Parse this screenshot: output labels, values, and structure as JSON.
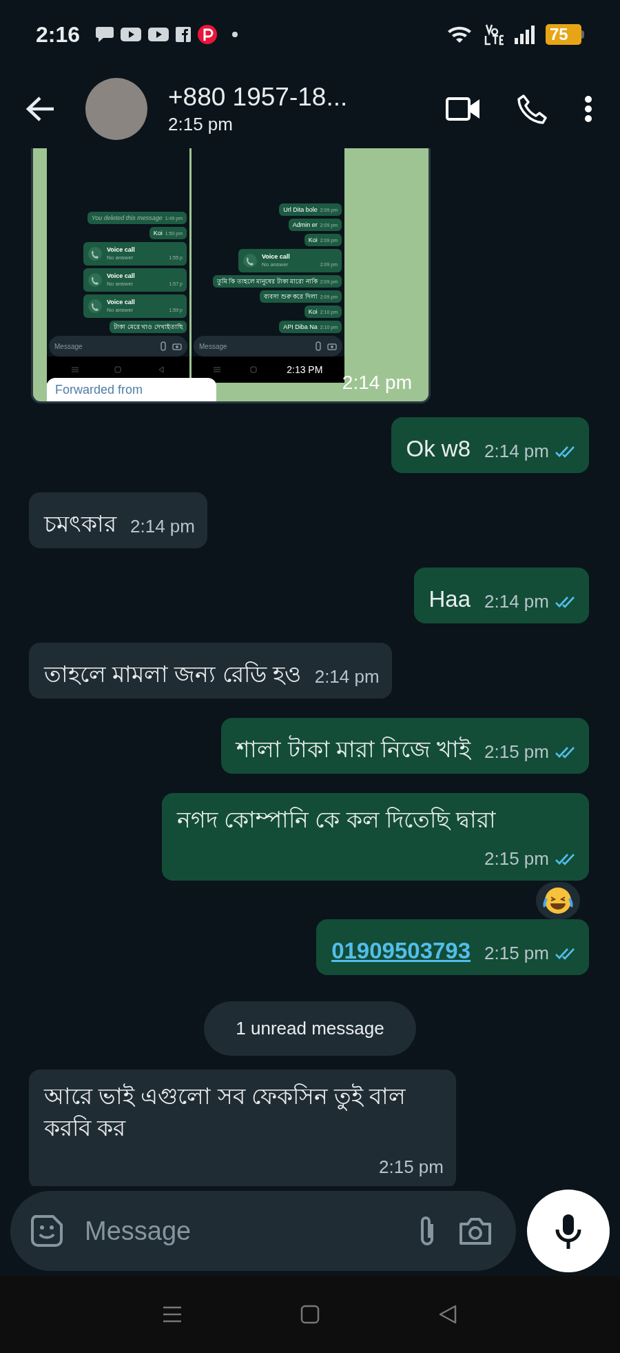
{
  "status_bar": {
    "time": "2:16",
    "battery": "75"
  },
  "header": {
    "contact": "+880 1957-18...",
    "subtitle": "2:15 pm"
  },
  "messages": [
    {
      "kind": "image",
      "outgoing": false,
      "time": "2:14 pm",
      "forwarded_label": "Forwarded from",
      "screens": [
        {
          "items": [
            {
              "kind": "deleted",
              "text": "You deleted this message",
              "time": "1:49 pm"
            },
            {
              "kind": "text",
              "text": "Koi",
              "time": "1:50 pm"
            },
            {
              "kind": "call",
              "title": "Voice call",
              "sub": "No answer",
              "time": "1:55 p"
            },
            {
              "kind": "call",
              "title": "Voice call",
              "sub": "No answer",
              "time": "1:57 p"
            },
            {
              "kind": "call",
              "title": "Voice call",
              "sub": "No answer",
              "time": "1:59 p"
            },
            {
              "kind": "text",
              "text": "টাকা মেরে খাও দেখাইতাছি"
            }
          ],
          "placeholder": "Message"
        },
        {
          "items": [
            {
              "kind": "text",
              "text": "Url Dita bole",
              "time": "2:09 pm"
            },
            {
              "kind": "text",
              "text": "Admin er",
              "time": "2:09 pm"
            },
            {
              "kind": "text",
              "text": "Koi",
              "time": "2:09 pm"
            },
            {
              "kind": "call",
              "title": "Voice call",
              "sub": "No answer",
              "time": "2:09 pm"
            },
            {
              "kind": "text",
              "text": "তুমি কি তাহলে মানুষের টাকা মারো নাকি",
              "time": "2:09 pm"
            },
            {
              "kind": "text",
              "text": "ব্যবসা শুরু করে দিলা",
              "time": "2:09 pm"
            },
            {
              "kind": "text",
              "text": "Koi",
              "time": "2:10 pm"
            },
            {
              "kind": "text",
              "text": "API Diba Na",
              "time": "2:10 pm"
            }
          ],
          "placeholder": "Message",
          "clock": "2:13 PM"
        }
      ]
    },
    {
      "kind": "text",
      "outgoing": true,
      "text": "Ok w8",
      "time": "2:14 pm",
      "read": true
    },
    {
      "kind": "text",
      "outgoing": false,
      "text": "চমৎকার",
      "time": "2:14 pm"
    },
    {
      "kind": "text",
      "outgoing": true,
      "text": "Haa",
      "time": "2:14 pm",
      "read": true
    },
    {
      "kind": "text",
      "outgoing": false,
      "text": "তাহলে মামলা জন্য রেডি হও",
      "time": "2:14 pm"
    },
    {
      "kind": "text",
      "outgoing": true,
      "text": "শালা টাকা মারা নিজে খাই",
      "time": "2:15 pm",
      "read": true
    },
    {
      "kind": "text",
      "outgoing": true,
      "text": "নগদ কোম্পানি কে কল দিতেছি দ্বারা",
      "time": "2:15 pm",
      "read": true,
      "reaction": true
    },
    {
      "kind": "link",
      "outgoing": true,
      "text": "01909503793",
      "time": "2:15 pm",
      "read": true
    },
    {
      "kind": "unread_divider",
      "text": "1 unread message"
    },
    {
      "kind": "text",
      "outgoing": false,
      "text": "আরে ভাই এগুলো সব ফেকসিন তুই  বাল করবি কর",
      "time": "2:15 pm"
    }
  ],
  "composer": {
    "placeholder": "Message"
  }
}
